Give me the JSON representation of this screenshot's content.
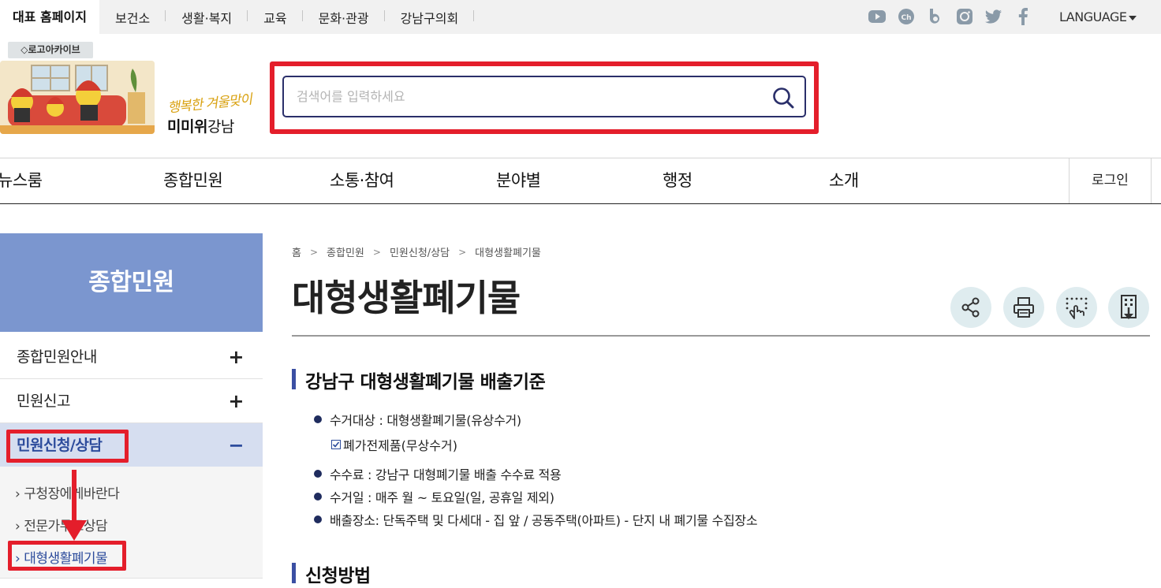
{
  "topbar": {
    "home_label": "대표 홈페이지",
    "links": [
      "보건소",
      "생활·복지",
      "교육",
      "문화·관광",
      "강남구의회"
    ],
    "social_icons": [
      "youtube-icon",
      "kakao-channel-icon",
      "blog-icon",
      "instagram-icon",
      "twitter-icon",
      "facebook-icon"
    ],
    "language_label": "LANGUAGE"
  },
  "logo": {
    "archive_label": "로고아카이브",
    "tagline": "행복한 겨울맞이",
    "name_bold": "미미위",
    "name_light": "강남"
  },
  "search": {
    "placeholder": "검색어를 입력하세요",
    "value": "",
    "highlight_color": "#e41e2b"
  },
  "gnb": {
    "items": [
      "뉴스룸",
      "종합민원",
      "소통·참여",
      "분야별",
      "행정",
      "소개"
    ],
    "login_label": "로그인"
  },
  "lnb": {
    "title": "종합민원",
    "items": [
      {
        "label": "종합민원안내",
        "toggle": "+"
      },
      {
        "label": "민원신고",
        "toggle": "+"
      },
      {
        "label": "민원신청/상담",
        "toggle": "−"
      }
    ],
    "sub_items": [
      "구청장에게바란다",
      "전문가무료상담",
      "대형생활폐기물"
    ],
    "sub_prefix": "›",
    "accent_color": "#7b96cf"
  },
  "content": {
    "breadcrumb": [
      "홈",
      "종합민원",
      "민원신청/상담",
      "대형생활폐기물"
    ],
    "breadcrumb_sep": ">",
    "title": "대형생활폐기물",
    "tools": [
      "share-icon",
      "print-icon",
      "touch-icon",
      "building-download-icon"
    ],
    "sections": [
      {
        "title": "강남구 대형생활폐기물 배출기준",
        "bullets": [
          "수거대상 : 대형생활폐기물(유상수거)",
          "수수료 : 강남구 대형폐기물 배출 수수료 적용",
          "수거일 : 매주 월 ~ 토요일(일, 공휴일 제외)",
          "배출장소: 단독주택 및 다세대 - 집 앞 / 공동주택(아파트) - 단지 내 폐기물 수집장소"
        ],
        "sub_check": "폐가전제품(무상수거)"
      },
      {
        "title": "신청방법"
      }
    ]
  }
}
